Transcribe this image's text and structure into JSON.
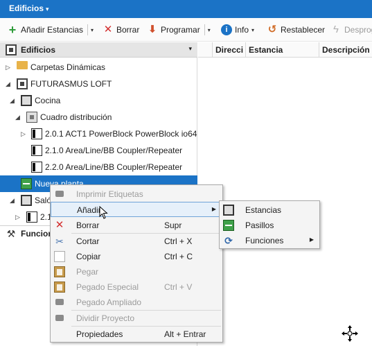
{
  "title": {
    "label": "Edificios",
    "caret": "▾"
  },
  "toolbar": {
    "add_label": "Añadir Estancias",
    "delete_label": "Borrar",
    "program_label": "Programar",
    "info_label": "Info",
    "reset_label": "Restablecer",
    "deprog_label": "Desprog",
    "dropdown_glyph": "▾"
  },
  "panel": {
    "title": "Edificios",
    "menu_glyph": "▾"
  },
  "tree": [
    {
      "label": "Carpetas Dinámicas",
      "icon": "folder-icon",
      "exp": "▷"
    },
    {
      "label": "FUTURASMUS LOFT",
      "icon": "building-icon",
      "exp": "◢"
    },
    {
      "label": "Cocina",
      "icon": "room-icon",
      "exp": "◢"
    },
    {
      "label": "Cuadro distribución",
      "icon": "cabinet-icon",
      "exp": "◢"
    },
    {
      "label": "2.0.1 ACT1 PowerBlock PowerBlock io64",
      "icon": "device-icon",
      "exp": "▷"
    },
    {
      "label": "2.1.0 Area/Line/BB Coupler/Repeater",
      "icon": "device-icon",
      "exp": ""
    },
    {
      "label": "2.2.0 Area/Line/BB Coupler/Repeater",
      "icon": "device-icon",
      "exp": ""
    },
    {
      "label": "Nueva planta",
      "icon": "floor-icon",
      "exp": ""
    },
    {
      "label": "Saló",
      "icon": "room-icon",
      "exp": "◢"
    },
    {
      "label": "2.1",
      "icon": "device-icon",
      "exp": "▷"
    }
  ],
  "functions_bar": {
    "label": "Funcion"
  },
  "grid": {
    "columns": [
      "Direcci",
      "Estancia",
      "Descripción"
    ]
  },
  "context_menu": {
    "items": [
      {
        "label": "Imprimir Etiquetas",
        "shortcut": "",
        "icon": "lock-icon",
        "disabled": true,
        "submenu": false
      },
      {
        "label": "Añadir",
        "shortcut": "",
        "icon": "",
        "disabled": false,
        "submenu": true
      },
      {
        "label": "Borrar",
        "shortcut": "Supr",
        "icon": "delete-icon",
        "disabled": false,
        "submenu": false
      },
      {
        "label": "Cortar",
        "shortcut": "Ctrl + X",
        "icon": "cut-icon",
        "disabled": false,
        "submenu": false
      },
      {
        "label": "Copiar",
        "shortcut": "Ctrl + C",
        "icon": "copy-icon",
        "disabled": false,
        "submenu": false
      },
      {
        "label": "Pegar",
        "shortcut": "",
        "icon": "paste-icon",
        "disabled": true,
        "submenu": false
      },
      {
        "label": "Pegado Especial",
        "shortcut": "Ctrl + V",
        "icon": "paste-special-icon",
        "disabled": true,
        "submenu": false
      },
      {
        "label": "Pegado Ampliado",
        "shortcut": "",
        "icon": "lock-icon",
        "disabled": true,
        "submenu": false
      },
      {
        "label": "Dividir Proyecto",
        "shortcut": "",
        "icon": "lock-icon",
        "disabled": true,
        "submenu": false
      },
      {
        "label": "Propiedades",
        "shortcut": "Alt + Entrar",
        "icon": "",
        "disabled": false,
        "submenu": false
      }
    ],
    "submenu_glyph": "▶"
  },
  "submenu": {
    "items": [
      {
        "label": "Estancias",
        "icon": "room-icon",
        "submenu": false
      },
      {
        "label": "Pasillos",
        "icon": "corridor-icon",
        "submenu": false
      },
      {
        "label": "Funciones",
        "icon": "functions-icon",
        "submenu": true
      }
    ]
  },
  "colors": {
    "accent": "#1b73c6",
    "selection": "#1b73c6",
    "menu_bg": "#f4f4f4"
  }
}
